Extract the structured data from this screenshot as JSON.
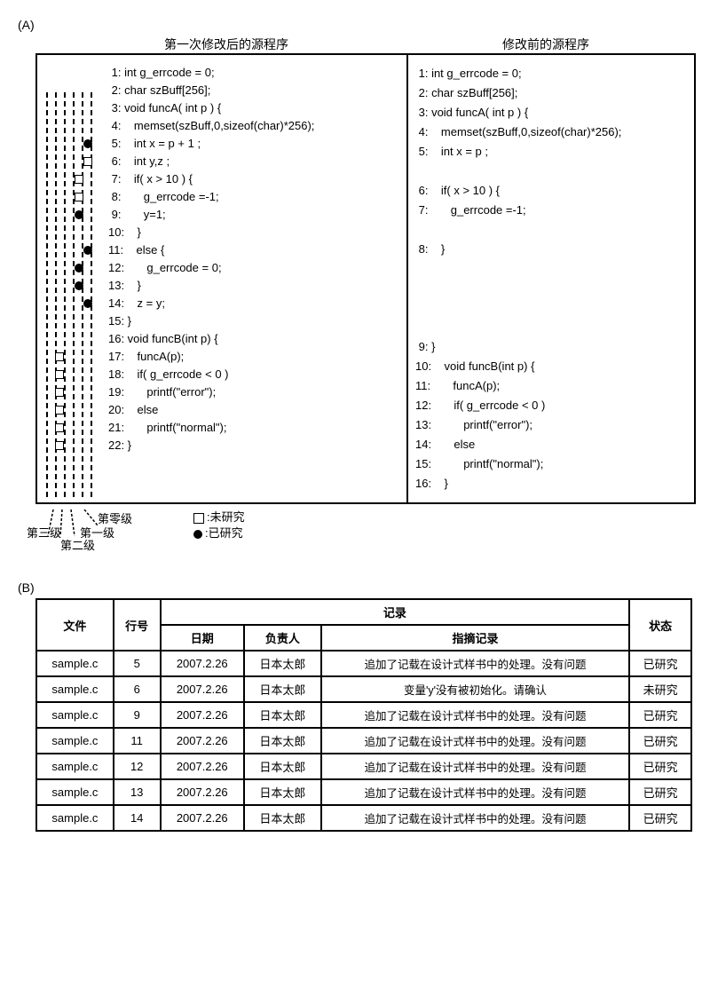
{
  "sectionA": {
    "label": "(A)",
    "leftTitle": "第一次修改后的源程序",
    "rightTitle": "修改前的源程序"
  },
  "leftCode": [
    {
      "n": "1",
      "text": "int g_errcode = 0;",
      "level": null,
      "mark": null
    },
    {
      "n": "2",
      "text": "char szBuff[256];",
      "level": null,
      "mark": null
    },
    {
      "n": "3",
      "text": "void funcA( int p ) {",
      "level": 0,
      "mark": null
    },
    {
      "n": "4",
      "text": "   memset(szBuff,0,sizeof(char)*256);",
      "level": 1,
      "mark": null
    },
    {
      "n": "5",
      "text": "   int x = p + 1 ;",
      "level": 1,
      "mark": "filled"
    },
    {
      "n": "6",
      "text": "   int y,z ;",
      "level": 1,
      "mark": "open"
    },
    {
      "n": "7",
      "text": "   if( x > 10 ) {",
      "level": 2,
      "mark": "open"
    },
    {
      "n": "8",
      "text": "      g_errcode =-1;",
      "level": 2,
      "mark": "open"
    },
    {
      "n": "9",
      "text": "      y=1;",
      "level": 2,
      "mark": "filled"
    },
    {
      "n": "10",
      "text": "   }",
      "level": 1,
      "mark": null
    },
    {
      "n": "11",
      "text": "   else {",
      "level": 1,
      "mark": "filled"
    },
    {
      "n": "12",
      "text": "      g_errcode = 0;",
      "level": 2,
      "mark": "filled"
    },
    {
      "n": "13",
      "text": "   }",
      "level": 2,
      "mark": "filled"
    },
    {
      "n": "14",
      "text": "   z = y;",
      "level": 1,
      "mark": "filled"
    },
    {
      "n": "15",
      "text": "}",
      "level": 0,
      "mark": null
    },
    {
      "n": "16",
      "text": "void funcB(int p) {",
      "level": 3,
      "mark": null
    },
    {
      "n": "17",
      "text": "   funcA(p);",
      "level": 3,
      "mark": "open"
    },
    {
      "n": "18",
      "text": "   if( g_errcode < 0 )",
      "level": 3,
      "mark": "open"
    },
    {
      "n": "19",
      "text": "      printf(\"error\");",
      "level": 3,
      "mark": "open"
    },
    {
      "n": "20",
      "text": "   else",
      "level": 3,
      "mark": "open"
    },
    {
      "n": "21",
      "text": "      printf(\"normal\");",
      "level": 3,
      "mark": "open"
    },
    {
      "n": "22",
      "text": "}",
      "level": 3,
      "mark": "open"
    }
  ],
  "rightCode": [
    {
      "n": "1",
      "text": "int g_errcode = 0;"
    },
    {
      "n": "2",
      "text": "char szBuff[256];"
    },
    {
      "n": "3",
      "text": "void funcA( int p ) {"
    },
    {
      "n": "4",
      "text": "   memset(szBuff,0,sizeof(char)*256);"
    },
    {
      "n": "5",
      "text": "   int x = p ;"
    },
    {
      "n": "",
      "text": ""
    },
    {
      "n": "6",
      "text": "   if( x > 10 ) {"
    },
    {
      "n": "7",
      "text": "      g_errcode =-1;"
    },
    {
      "n": "",
      "text": ""
    },
    {
      "n": "8",
      "text": "   }"
    },
    {
      "n": "",
      "text": ""
    },
    {
      "n": "",
      "text": ""
    },
    {
      "n": "",
      "text": ""
    },
    {
      "n": "",
      "text": ""
    },
    {
      "n": "9",
      "text": "}"
    },
    {
      "n": "10",
      "text": "   void funcB(int p) {"
    },
    {
      "n": "11",
      "text": "      funcA(p);"
    },
    {
      "n": "12",
      "text": "      if( g_errcode < 0 )"
    },
    {
      "n": "13",
      "text": "         printf(\"error\");"
    },
    {
      "n": "14",
      "text": "      else"
    },
    {
      "n": "15",
      "text": "         printf(\"normal\");"
    },
    {
      "n": "16",
      "text": "   }"
    }
  ],
  "levelLegend": {
    "level0": "第零级",
    "level1": "第一级",
    "level2": "第二级",
    "level3": "第三级",
    "openLabel": ":未研究",
    "filledLabel": ":已研究"
  },
  "sectionB": {
    "label": "(B)"
  },
  "tableHeaders": {
    "file": "文件",
    "line": "行号",
    "record": "记录",
    "date": "日期",
    "owner": "负责人",
    "note": "指摘记录",
    "state": "状态"
  },
  "tableRows": [
    {
      "file": "sample.c",
      "line": "5",
      "date": "2007.2.26",
      "owner": "日本太郎",
      "note": "追加了记载在设计式样书中的处理。没有问题",
      "state": "已研究"
    },
    {
      "file": "sample.c",
      "line": "6",
      "date": "2007.2.26",
      "owner": "日本太郎",
      "note": "变量'y'没有被初始化。请确认",
      "state": "未研究"
    },
    {
      "file": "sample.c",
      "line": "9",
      "date": "2007.2.26",
      "owner": "日本太郎",
      "note": "追加了记载在设计式样书中的处理。没有问题",
      "state": "已研究"
    },
    {
      "file": "sample.c",
      "line": "11",
      "date": "2007.2.26",
      "owner": "日本太郎",
      "note": "追加了记载在设计式样书中的处理。没有问题",
      "state": "已研究"
    },
    {
      "file": "sample.c",
      "line": "12",
      "date": "2007.2.26",
      "owner": "日本太郎",
      "note": "追加了记载在设计式样书中的处理。没有问题",
      "state": "已研究"
    },
    {
      "file": "sample.c",
      "line": "13",
      "date": "2007.2.26",
      "owner": "日本太郎",
      "note": "追加了记载在设计式样书中的处理。没有问题",
      "state": "已研究"
    },
    {
      "file": "sample.c",
      "line": "14",
      "date": "2007.2.26",
      "owner": "日本太郎",
      "note": "追加了记载在设计式样书中的处理。没有问题",
      "state": "已研究"
    }
  ]
}
